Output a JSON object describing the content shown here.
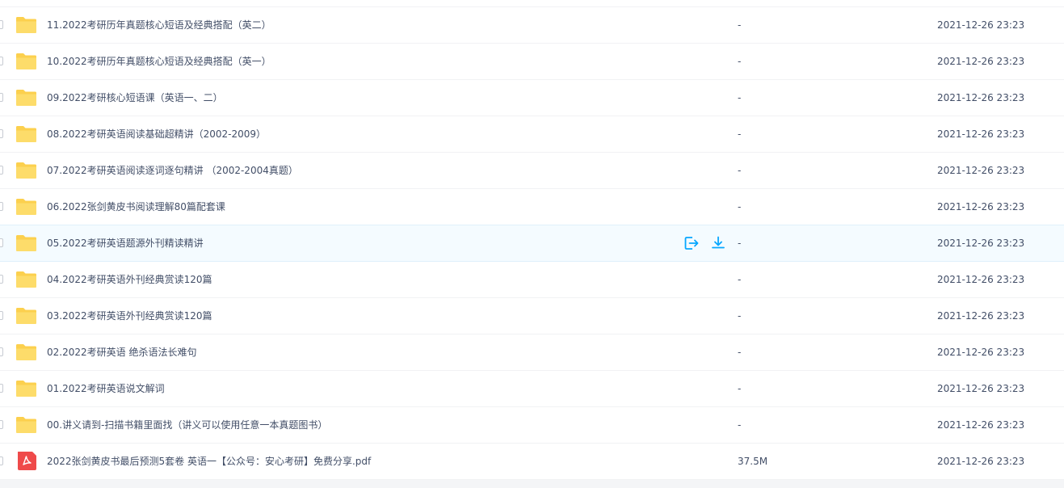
{
  "files": [
    {
      "name": "11.2022考研历年真题核心短语及经典搭配（英二）",
      "type": "folder",
      "size": "-",
      "modified": "2021-12-26 23:23"
    },
    {
      "name": "10.2022考研历年真题核心短语及经典搭配（英一）",
      "type": "folder",
      "size": "-",
      "modified": "2021-12-26 23:23"
    },
    {
      "name": "09.2022考研核心短语课（英语一、二）",
      "type": "folder",
      "size": "-",
      "modified": "2021-12-26 23:23"
    },
    {
      "name": "08.2022考研英语阅读基础超精讲（2002-2009）",
      "type": "folder",
      "size": "-",
      "modified": "2021-12-26 23:23"
    },
    {
      "name": "07.2022考研英语阅读逐词逐句精讲 （2002-2004真题）",
      "type": "folder",
      "size": "-",
      "modified": "2021-12-26 23:23"
    },
    {
      "name": "06.2022张剑黄皮书阅读理解80篇配套课",
      "type": "folder",
      "size": "-",
      "modified": "2021-12-26 23:23"
    },
    {
      "name": "05.2022考研英语题源外刊精读精讲",
      "type": "folder",
      "size": "-",
      "modified": "2021-12-26 23:23",
      "hovered": true
    },
    {
      "name": "04.2022考研英语外刊经典赏读120篇",
      "type": "folder",
      "size": "-",
      "modified": "2021-12-26 23:23"
    },
    {
      "name": "03.2022考研英语外刊经典赏读120篇",
      "type": "folder",
      "size": "-",
      "modified": "2021-12-26 23:23"
    },
    {
      "name": "02.2022考研英语 绝杀语法长难句",
      "type": "folder",
      "size": "-",
      "modified": "2021-12-26 23:23"
    },
    {
      "name": "01.2022考研英语说文解词",
      "type": "folder",
      "size": "-",
      "modified": "2021-12-26 23:23"
    },
    {
      "name": "00.讲义请到-扫描书籍里面找（讲义可以使用任意一本真题图书）",
      "type": "folder",
      "size": "-",
      "modified": "2021-12-26 23:23"
    },
    {
      "name": "2022张剑黄皮书最后预测5套卷 英语一【公众号：安心考研】免费分享.pdf",
      "type": "pdf",
      "size": "37.5M",
      "modified": "2021-12-26 23:23"
    }
  ],
  "row_actions": {
    "share_icon": "share-out-icon",
    "download_icon": "download-icon"
  },
  "colors": {
    "folder": "#fcd04e",
    "pdf": "#ef4a4a",
    "accent": "#06a7ff",
    "hover_row": "#f4fbff",
    "text": "#424e67"
  }
}
